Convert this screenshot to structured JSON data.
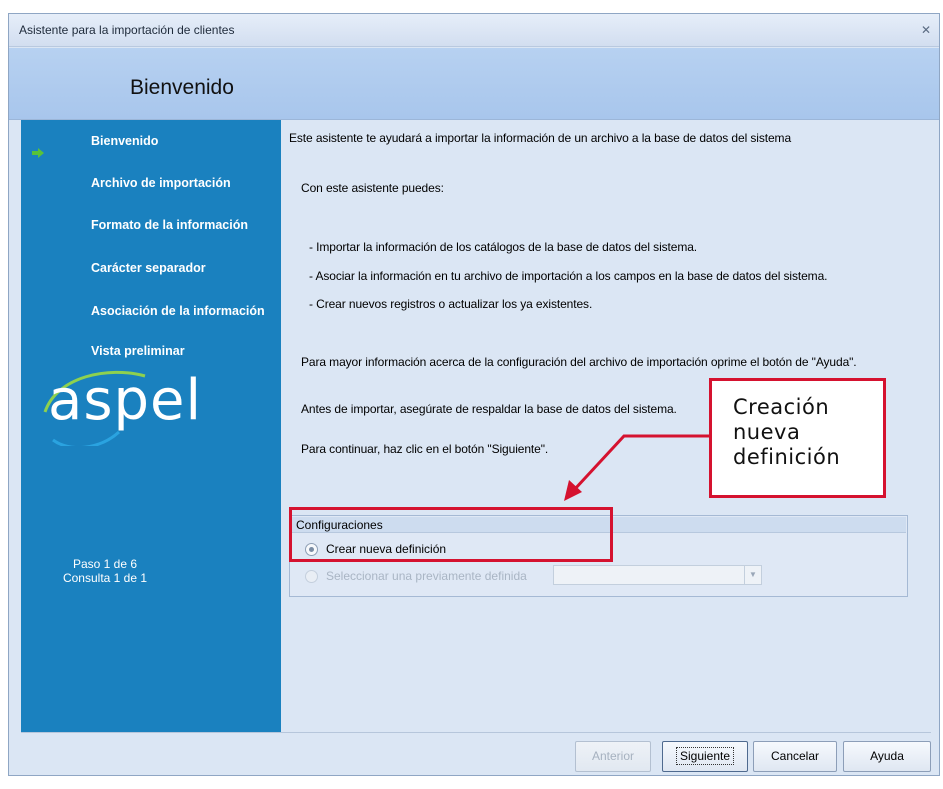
{
  "window": {
    "title": "Asistente para la importación de clientes",
    "close_icon": "close-icon"
  },
  "header": {
    "title": "Bienvenido"
  },
  "sidebar": {
    "steps": [
      {
        "label": "Bienvenido",
        "active": true
      },
      {
        "label": "Archivo de importación"
      },
      {
        "label": "Formato de la información"
      },
      {
        "label": "Carácter separador"
      },
      {
        "label": "Asociación de la información"
      },
      {
        "label": "Vista preliminar"
      }
    ],
    "logo": "aspel",
    "paso": "Paso 1 de 6",
    "consulta": "Consulta 1 de 1"
  },
  "main": {
    "intro": "Este asistente te ayudará a importar la información de un archivo a la base de datos del sistema",
    "can_do": "Con este asistente puedes:",
    "bullets": [
      "- Importar la información de los catálogos de la base de datos del sistema.",
      "- Asociar la información en tu archivo de importación a los campos en la base de datos del sistema.",
      "- Crear nuevos registros o actualizar los ya existentes."
    ],
    "help_text": "Para mayor información acerca de la configuración del archivo de importación oprime el botón de \"Ayuda\".",
    "backup_text": "Antes de importar, asegúrate de respaldar la base de datos del sistema.",
    "continue_text": "Para continuar, haz clic en el botón \"Siguiente\"."
  },
  "configuraciones": {
    "title": "Configuraciones",
    "option_new": "Crear nueva definición",
    "option_existing": "Seleccionar una previamente definida",
    "selected": "new",
    "combo_value": ""
  },
  "buttons": {
    "anterior": "Anterior",
    "siguiente": "Siguiente",
    "cancelar": "Cancelar",
    "ayuda": "Ayuda"
  },
  "annotation": {
    "callout": "Creación\nnueva\ndefinición",
    "color": "#d5122f"
  },
  "colors": {
    "sidebar": "#1a81bf",
    "header": "#b0cbee",
    "background": "#dbe6f4"
  }
}
